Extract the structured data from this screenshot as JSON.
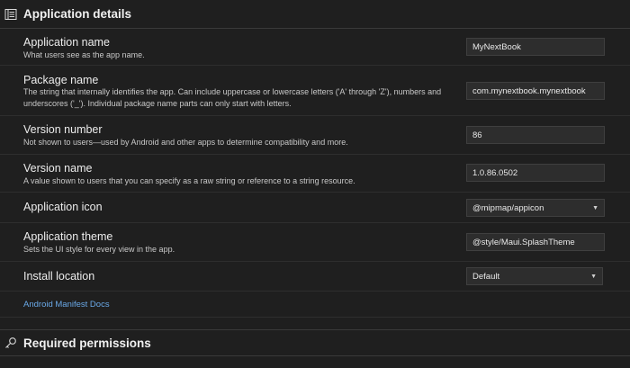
{
  "section": {
    "title": "Application details"
  },
  "fields": {
    "app_name": {
      "label": "Application name",
      "desc": "What users see as the app name.",
      "value": "MyNextBook"
    },
    "package_name": {
      "label": "Package name",
      "desc": "The string that internally identifies the app. Can include uppercase or lowercase letters ('A' through 'Z'), numbers and underscores ('_'). Individual package name parts can only start with letters.",
      "value": "com.mynextbook.mynextbook"
    },
    "version_number": {
      "label": "Version number",
      "desc": "Not shown to users—used by Android and other apps to determine compatibility and more.",
      "value": "86"
    },
    "version_name": {
      "label": "Version name",
      "desc": "A value shown to users that you can specify as a raw string or reference to a string resource.",
      "value": "1.0.86.0502"
    },
    "app_icon": {
      "label": "Application icon",
      "value": "@mipmap/appicon"
    },
    "app_theme": {
      "label": "Application theme",
      "desc": "Sets the UI style for every view in the app.",
      "value": "@style/Maui.SplashTheme"
    },
    "install_location": {
      "label": "Install location",
      "value": "Default"
    }
  },
  "docs_link": "Android Manifest Docs",
  "permissions": {
    "title": "Required permissions"
  },
  "icons": {
    "section": "list-detail-icon",
    "permissions": "key-icon",
    "dropdown": "chevron-down-icon"
  }
}
